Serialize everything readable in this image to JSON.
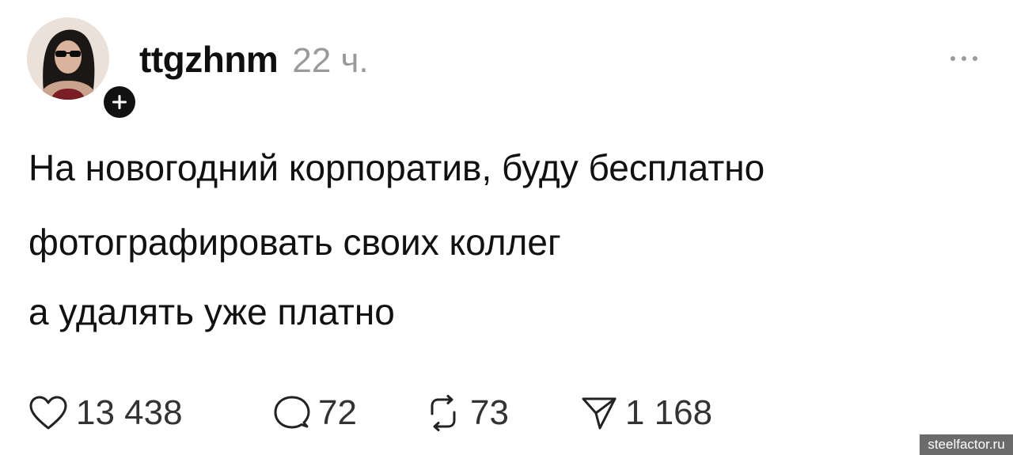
{
  "post": {
    "username": "ttgzhnm",
    "time": "22 ч.",
    "lines": [
      "На новогодний корпоратив, буду бесплатно",
      "фотографировать своих коллег",
      "а удалять уже платно"
    ],
    "actions": {
      "likes": "13 438",
      "replies": "72",
      "reposts": "73",
      "shares": "1 168"
    }
  },
  "icons": {
    "follow": "plus-icon",
    "more": "more-dots-icon",
    "like": "heart-icon",
    "reply": "comment-bubble-icon",
    "repost": "repost-arrows-icon",
    "share": "send-paper-plane-icon"
  },
  "watermark": {
    "text": "steelfactor.ru"
  }
}
